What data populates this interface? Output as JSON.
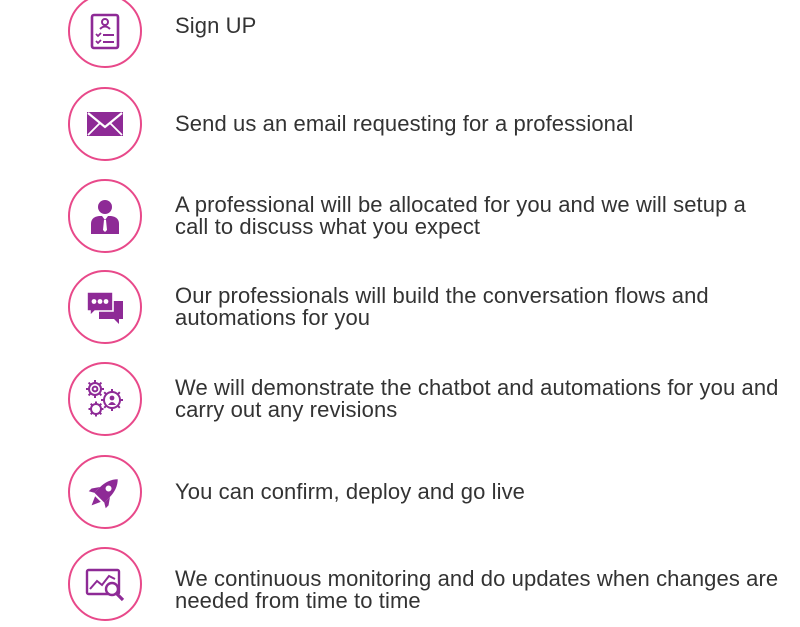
{
  "steps": [
    {
      "icon": "clipboard-checklist-icon",
      "text": "Sign UP"
    },
    {
      "icon": "envelope-icon",
      "text": "Send us an email requesting for a professional"
    },
    {
      "icon": "professional-person-icon",
      "text": "A professional will be allocated for you and we will setup a call to discuss what you expect"
    },
    {
      "icon": "chat-bubbles-icon",
      "text": "Our professionals will build the conversation flows and automations for you"
    },
    {
      "icon": "gears-icon",
      "text": "We will demonstrate the chatbot and automations for you and carry out any revisions"
    },
    {
      "icon": "rocket-icon",
      "text": "You can confirm, deploy and go live"
    },
    {
      "icon": "monitoring-chart-icon",
      "text": "We continuous monitoring and do updates when changes are needed from time to time"
    }
  ],
  "colors": {
    "accent": "#e8498a",
    "icon": "#8e2a96",
    "text": "#333333"
  }
}
